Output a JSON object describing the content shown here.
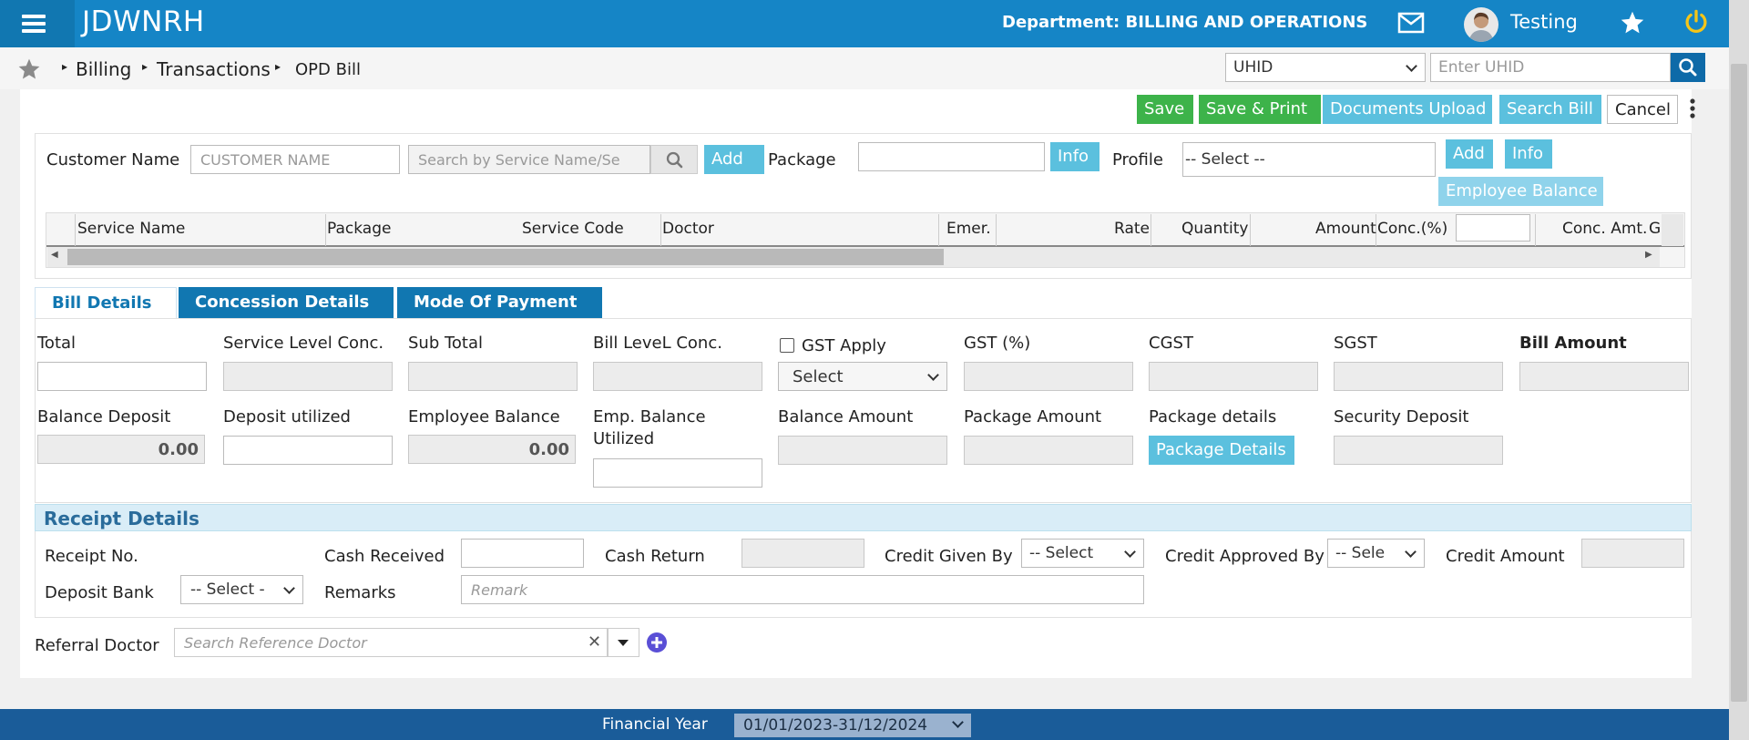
{
  "header": {
    "brand": "JDWNRH",
    "department": "Department: BILLING AND OPERATIONS",
    "user": "Testing"
  },
  "breadcrumb": [
    "Billing",
    "Transactions",
    "OPD Bill"
  ],
  "uhid": {
    "select_value": "UHID",
    "input_placeholder": "Enter UHID"
  },
  "toolbar": {
    "save": "Save",
    "save_print": "Save & Print",
    "documents_upload": "Documents Upload",
    "search_bill": "Search Bill",
    "cancel": "Cancel"
  },
  "service_entry": {
    "customer_label": "Customer Name",
    "customer_placeholder": "CUSTOMER NAME",
    "service_search_placeholder": "Search by Service Name/Se",
    "add": "Add",
    "package_label": "Package",
    "info": "Info",
    "profile_label": "Profile",
    "profile_select": "-- Select --",
    "add2": "Add",
    "info2": "Info",
    "employee_balance": "Employee Balance"
  },
  "grid_columns": [
    "Service Name",
    "Package",
    "Service Code",
    "Doctor",
    "Emer.",
    "Rate",
    "Quantity",
    "Amount",
    "Conc.(%)",
    "Conc. Amt.",
    "G"
  ],
  "tabs": [
    "Bill Details",
    "Concession Details",
    "Mode Of Payment"
  ],
  "bill": {
    "total": "Total",
    "service_level_conc": "Service Level Conc.",
    "sub_total": "Sub Total",
    "bill_level_conc": "Bill LeveL Conc.",
    "gst_apply": "GST Apply",
    "gst_select": "Select",
    "gst_pct": "GST (%)",
    "cgst": "CGST",
    "sgst": "SGST",
    "bill_amount": "Bill Amount",
    "balance_deposit": "Balance Deposit",
    "balance_deposit_value": "0.00",
    "deposit_utilized": "Deposit utilized",
    "employee_balance": "Employee Balance",
    "employee_balance_value": "0.00",
    "emp_balance_utilized_1": "Emp. Balance",
    "emp_balance_utilized_2": "Utilized",
    "balance_amount": "Balance Amount",
    "package_amount": "Package Amount",
    "package_details_label": "Package details",
    "package_details_btn": "Package Details",
    "security_deposit": "Security Deposit"
  },
  "receipt": {
    "title": "Receipt Details",
    "receipt_no": "Receipt No.",
    "cash_received": "Cash Received",
    "cash_return": "Cash Return",
    "credit_given_by": "Credit Given By",
    "credit_given_select": "-- Select",
    "credit_approved_by": "Credit Approved By",
    "credit_approved_select": "-- Sele",
    "credit_amount": "Credit Amount",
    "deposit_bank": "Deposit Bank",
    "deposit_bank_select": "-- Select -",
    "remarks": "Remarks",
    "remarks_placeholder": "Remark"
  },
  "referral": {
    "label": "Referral Doctor",
    "placeholder": "Search Reference Doctor"
  },
  "footer": {
    "label": "Financial Year",
    "value": "01/01/2023-31/12/2024"
  },
  "colors": {
    "topbar": "#1585c6",
    "green": "#3db34a",
    "light_blue": "#5bc0de",
    "tab_blue": "#1177b1",
    "footer": "#1a5c99"
  }
}
